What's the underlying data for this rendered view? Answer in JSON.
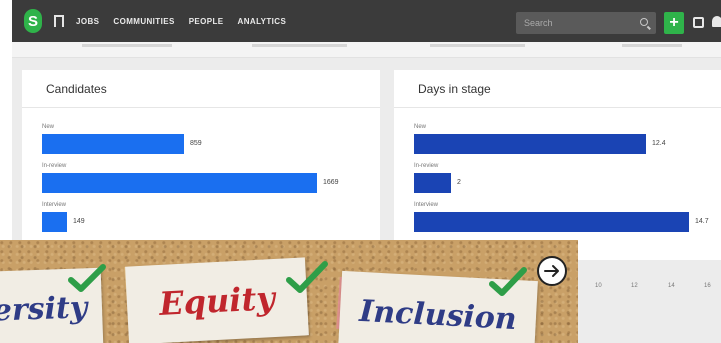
{
  "navbar": {
    "logo_letter": "S",
    "links": [
      "JOBS",
      "COMMUNITIES",
      "PEOPLE",
      "ANALYTICS"
    ],
    "search_placeholder": "Search",
    "plus_label": "+"
  },
  "cards": {
    "candidates": {
      "title": "Candidates",
      "bars": [
        {
          "label": "New",
          "value": 859
        },
        {
          "label": "In-review",
          "value": 1669
        },
        {
          "label": "Interview",
          "value": 149
        }
      ]
    },
    "days": {
      "title": "Days in stage",
      "bars": [
        {
          "label": "New",
          "value": 12.4
        },
        {
          "label": "In-review",
          "value": 2
        },
        {
          "label": "Interview",
          "value": 14.7
        }
      ],
      "x_ticks": [
        "10",
        "12",
        "14",
        "16"
      ]
    }
  },
  "banner": {
    "words": [
      "ersity",
      "Equity",
      "Inclusion"
    ],
    "colors": {
      "blue": "#2f3c86",
      "red": "#c0262d",
      "check": "#2e9e48"
    }
  },
  "colors": {
    "navbar": "#3b3b3b",
    "accent_green": "#2fb34a",
    "bar_candidates": "#1a6ff0",
    "bar_days": "#1a44b4"
  }
}
